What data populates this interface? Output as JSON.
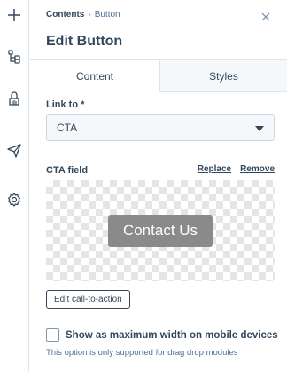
{
  "rail": {
    "icons": [
      "plus-icon",
      "tree-structure-icon",
      "paint-bucket-icon",
      "send-icon",
      "gear-icon"
    ]
  },
  "breadcrumb": {
    "parent": "Contents",
    "separator": "›",
    "current": "Button"
  },
  "header": {
    "title": "Edit Button"
  },
  "tabs": [
    {
      "label": "Content",
      "active": true
    },
    {
      "label": "Styles",
      "active": false
    }
  ],
  "link_to": {
    "label": "Link to *",
    "selected": "CTA"
  },
  "cta_field": {
    "label": "CTA field",
    "replace_label": "Replace",
    "remove_label": "Remove",
    "preview_button_text": "Contact Us",
    "edit_label": "Edit call-to-action"
  },
  "mobile_option": {
    "label": "Show as maximum width on mobile devices",
    "checked": false,
    "help": "This option is only supported for drag drop modules"
  },
  "colors": {
    "text": "#33475b",
    "border": "#dfe3eb",
    "cta_preview_bg": "#8a8a8a"
  }
}
